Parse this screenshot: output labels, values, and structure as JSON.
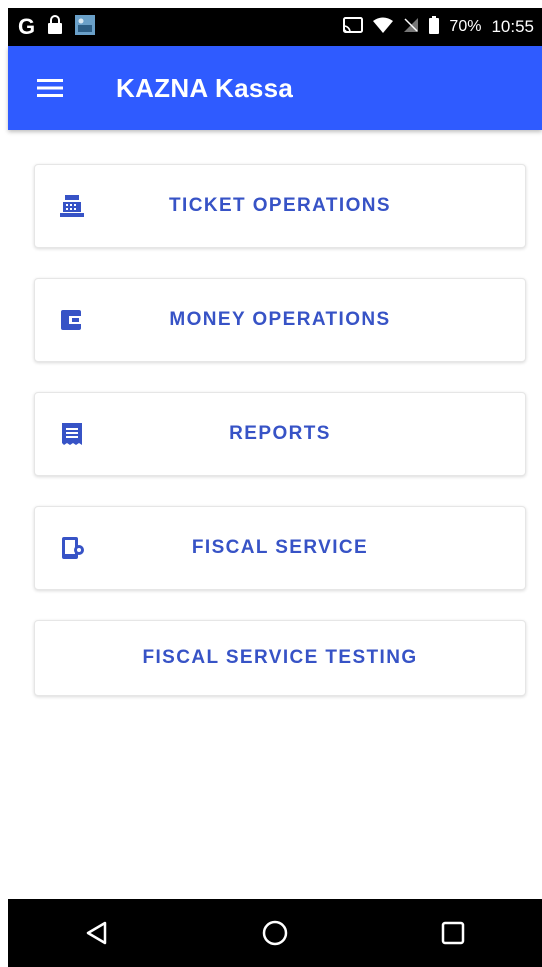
{
  "status_bar": {
    "left_glyph": "G",
    "left_icons": [
      "google-icon",
      "lock-icon",
      "image-thumbnail-icon"
    ],
    "right_icons": [
      "cast-icon",
      "wifi-icon",
      "no-signal-icon",
      "battery-icon"
    ],
    "battery": "70%",
    "time": "10:55"
  },
  "app_bar": {
    "title": "KAZNA Kassa",
    "menu_icon": "menu-icon",
    "color": "#2F5BFF"
  },
  "menu": [
    {
      "label": "TICKET OPERATIONS",
      "icon": "cash-register-icon"
    },
    {
      "label": "MONEY OPERATIONS",
      "icon": "wallet-icon"
    },
    {
      "label": "REPORTS",
      "icon": "receipt-icon"
    },
    {
      "label": "FISCAL SERVICE",
      "icon": "device-settings-icon"
    },
    {
      "label": "FISCAL SERVICE TESTING",
      "icon": ""
    }
  ],
  "nav_bar": {
    "buttons": [
      "back-icon",
      "home-icon",
      "recents-icon"
    ]
  },
  "colors": {
    "accent": "#2F5BFF",
    "button_text": "#3753C6"
  }
}
